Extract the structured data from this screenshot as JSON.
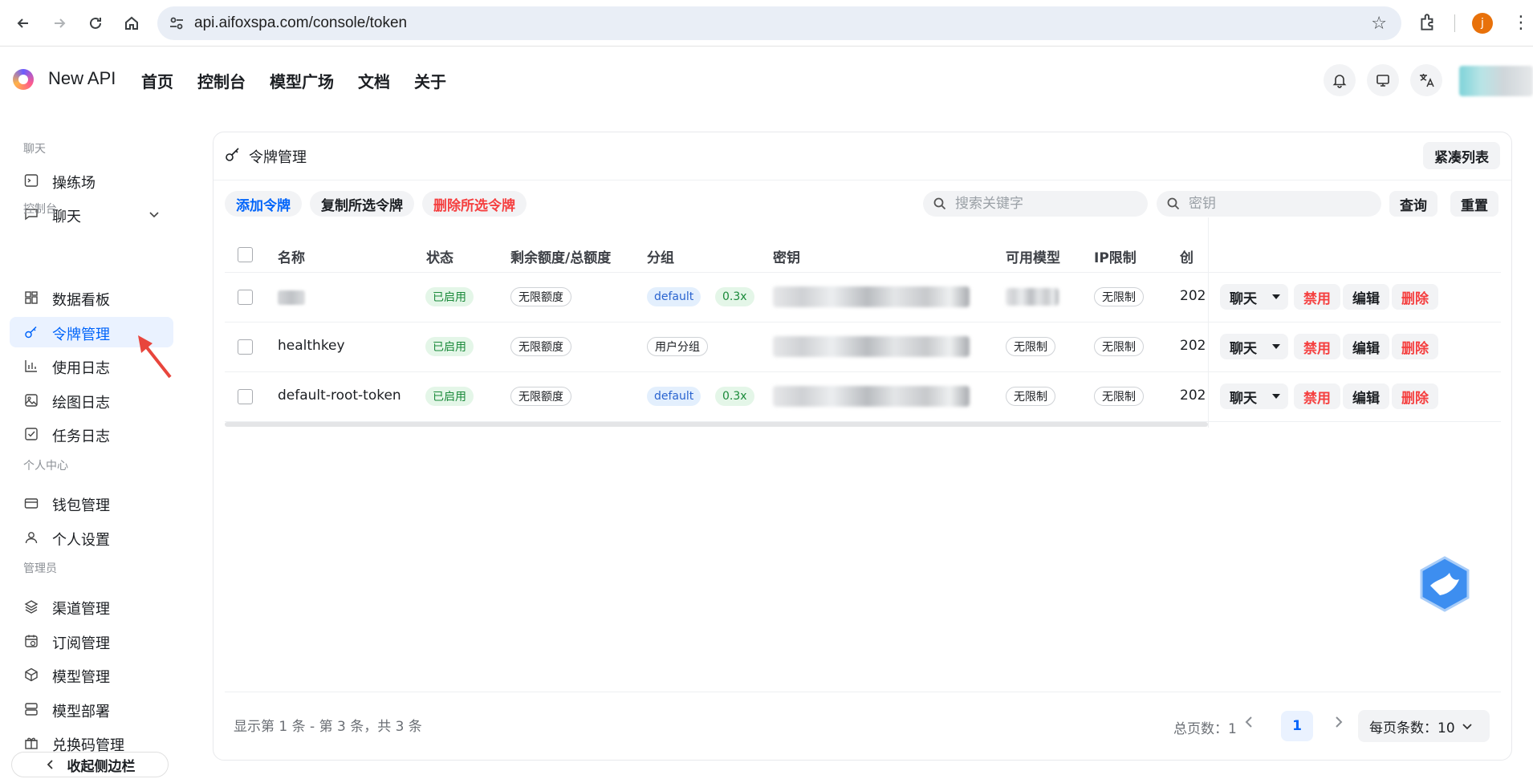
{
  "browser": {
    "url": "api.aifoxspa.com/console/token",
    "profile_initial": "j"
  },
  "header": {
    "brand": "New API",
    "nav": [
      "首页",
      "控制台",
      "模型广场",
      "文档",
      "关于"
    ]
  },
  "sidebar": {
    "sections": {
      "chat": "聊天",
      "console": "控制台",
      "personal": "个人中心",
      "admin": "管理员"
    },
    "items": {
      "playground": "操练场",
      "chat": "聊天",
      "dashboard": "数据看板",
      "tokens": "令牌管理",
      "usage_log": "使用日志",
      "drawing_log": "绘图日志",
      "task_log": "任务日志",
      "wallet": "钱包管理",
      "settings": "个人设置",
      "channels": "渠道管理",
      "subscriptions": "订阅管理",
      "models": "模型管理",
      "deploy": "模型部署",
      "redeem": "兑换码管理"
    },
    "collapse": "收起侧边栏"
  },
  "card": {
    "title": "令牌管理",
    "compact_list": "紧凑列表",
    "toolbar": {
      "add": "添加令牌",
      "copy_selected": "复制所选令牌",
      "delete_selected": "删除所选令牌",
      "search_placeholder": "搜索关键字",
      "key_placeholder": "密钥",
      "query": "查询",
      "reset": "重置"
    },
    "columns": [
      "名称",
      "状态",
      "剩余额度/总额度",
      "分组",
      "密钥",
      "可用模型",
      "IP限制",
      "创"
    ],
    "rows": [
      {
        "name": "",
        "status": "已启用",
        "quota": "无限额度",
        "group": "default",
        "ratio": "0.3x",
        "models": "",
        "ip": "无限制",
        "created": "202"
      },
      {
        "name": "healthkey",
        "status": "已启用",
        "quota": "无限额度",
        "group": "用户分组",
        "ratio": "",
        "models": "无限制",
        "ip": "无限制",
        "created": "202"
      },
      {
        "name": "default-root-token",
        "status": "已启用",
        "quota": "无限额度",
        "group": "default",
        "ratio": "0.3x",
        "models": "无限制",
        "ip": "无限制",
        "created": "202"
      }
    ],
    "actions": {
      "chat": "聊天",
      "disable": "禁用",
      "edit": "编辑",
      "delete": "删除"
    },
    "footer": {
      "info": "显示第 1 条 - 第 3 条，共 3 条",
      "total_pages": "总页数：1",
      "current_page": "1",
      "page_size": "每页条数：10"
    }
  },
  "colors": {
    "accent": "#0064fa",
    "danger": "#f53f3f",
    "success": "#1a8a3a"
  }
}
